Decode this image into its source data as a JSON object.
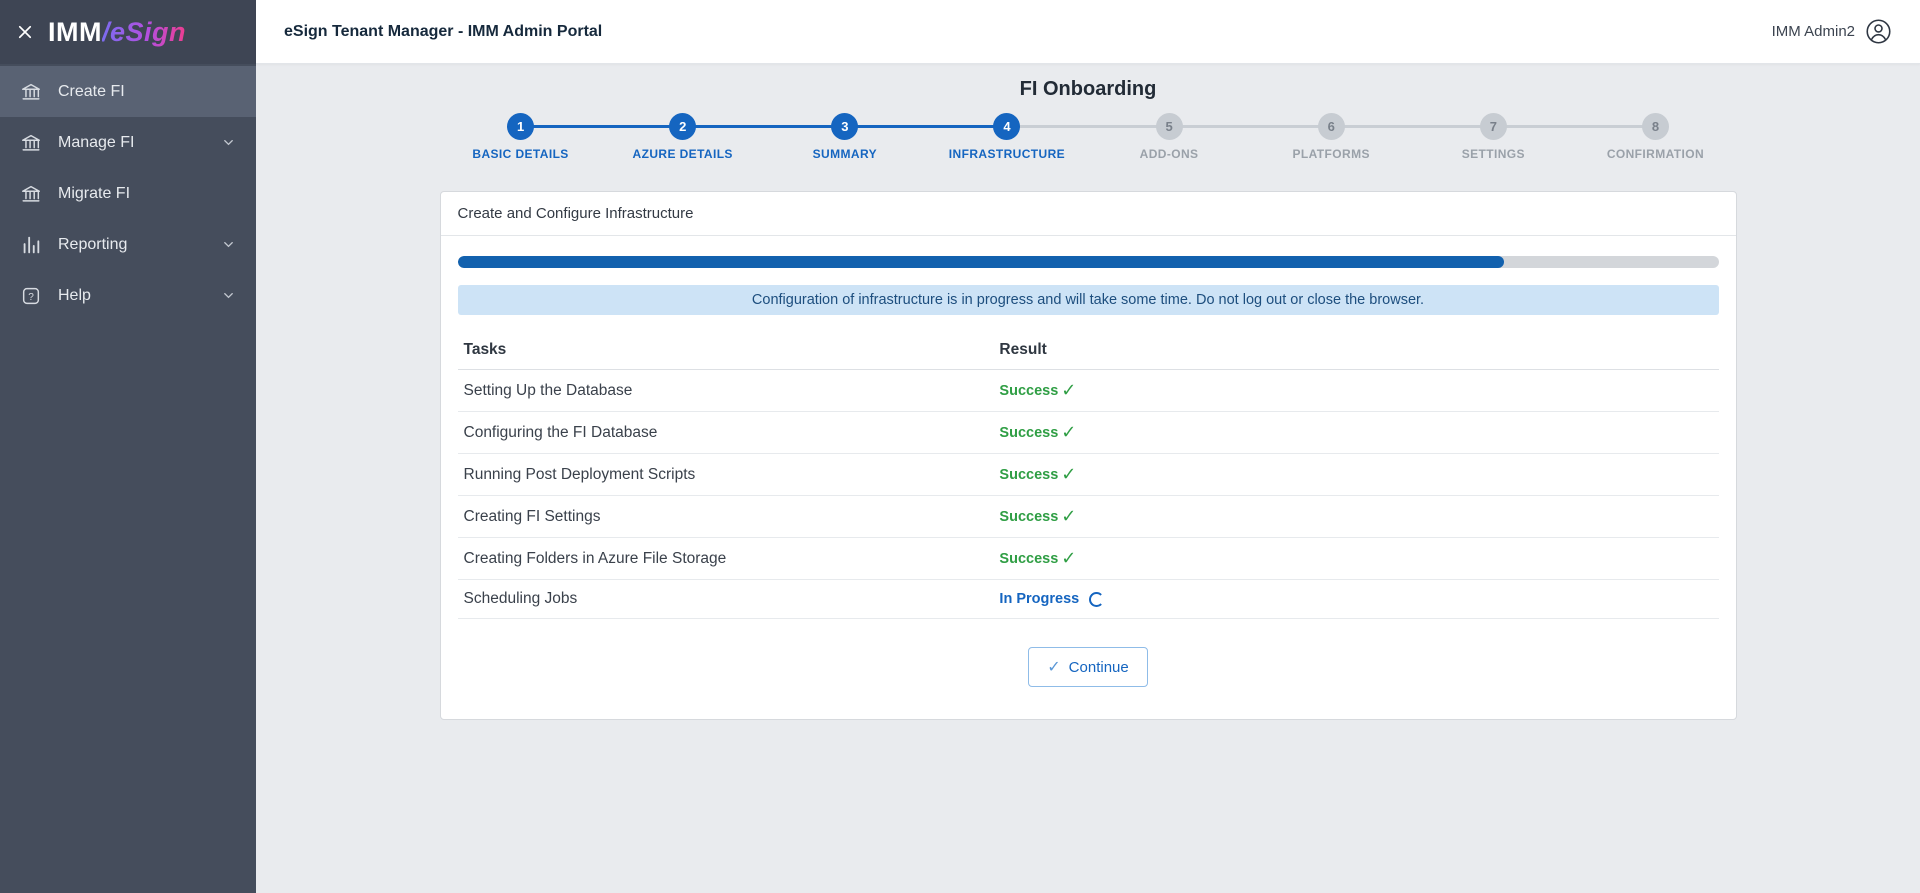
{
  "icons": {
    "check": "✓"
  },
  "colors": {
    "accent_blue": "#1565c0",
    "progress_blue": "#1261ae",
    "success_green": "#2f9e44",
    "banner_bg": "#cde3f6",
    "banner_text": "#1d4e7e",
    "sidebar_bg": "#454d5c"
  },
  "sidebar": {
    "logo_imm": "IMM",
    "logo_esign": "/eSign",
    "items": [
      {
        "label": "Create FI"
      },
      {
        "label": "Manage FI"
      },
      {
        "label": "Migrate FI"
      },
      {
        "label": "Reporting"
      },
      {
        "label": "Help"
      }
    ]
  },
  "header": {
    "title": "eSign Tenant Manager - IMM Admin Portal",
    "user_name": "IMM Admin2"
  },
  "main": {
    "page_title": "FI Onboarding",
    "steps": [
      {
        "num": "1",
        "label": "BASIC DETAILS",
        "state": "done"
      },
      {
        "num": "2",
        "label": "AZURE DETAILS",
        "state": "done"
      },
      {
        "num": "3",
        "label": "SUMMARY",
        "state": "done"
      },
      {
        "num": "4",
        "label": "INFRASTRUCTURE",
        "state": "current"
      },
      {
        "num": "5",
        "label": "ADD-ONS",
        "state": "upcoming"
      },
      {
        "num": "6",
        "label": "PLATFORMS",
        "state": "upcoming"
      },
      {
        "num": "7",
        "label": "SETTINGS",
        "state": "upcoming"
      },
      {
        "num": "8",
        "label": "CONFIRMATION",
        "state": "upcoming"
      }
    ],
    "card": {
      "title": "Create and Configure Infrastructure",
      "progress_percent": 83,
      "banner": "Configuration of infrastructure is in progress and will take some time. Do not log out or close the browser.",
      "table": {
        "tasks_header": "Tasks",
        "result_header": "Result",
        "rows": [
          {
            "task": "Setting Up the Database",
            "result": "Success",
            "status": "success"
          },
          {
            "task": "Configuring the FI Database",
            "result": "Success",
            "status": "success"
          },
          {
            "task": "Running Post Deployment Scripts",
            "result": "Success",
            "status": "success"
          },
          {
            "task": "Creating FI Settings",
            "result": "Success",
            "status": "success"
          },
          {
            "task": "Creating Folders in Azure File Storage",
            "result": "Success",
            "status": "success"
          },
          {
            "task": "Scheduling Jobs",
            "result": "In Progress",
            "status": "in_progress"
          }
        ]
      },
      "continue_button": "Continue"
    }
  }
}
